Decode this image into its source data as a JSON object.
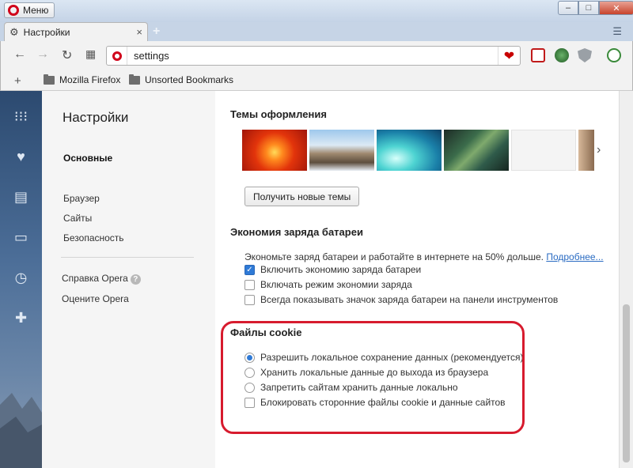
{
  "window": {
    "menu_label": "Меню",
    "controls": [
      "–",
      "□",
      "✕"
    ]
  },
  "tabs": [
    {
      "title": "Настройки",
      "close": "×"
    }
  ],
  "newtab_symbol": "+",
  "tabmenu_symbol": "☰",
  "navbar": {
    "url": "settings",
    "back": "←",
    "forward": "→",
    "reload": "↻",
    "speed_dial": "▦"
  },
  "bookmarks": {
    "add_symbol": "+",
    "items": [
      "Mozilla Firefox",
      "Unsorted Bookmarks"
    ]
  },
  "sidebar_icons": [
    "speed-dial-icon",
    "heart-icon",
    "news-icon",
    "devices-icon",
    "history-icon",
    "extensions-icon"
  ],
  "settings_nav": {
    "title": "Настройки",
    "active": "Основные",
    "items": [
      "Браузер",
      "Сайты",
      "Безопасность"
    ],
    "help": "Справка Opera",
    "rate": "Оцените Opera"
  },
  "themes": {
    "heading": "Темы оформления",
    "button": "Получить новые темы"
  },
  "battery": {
    "heading": "Экономия заряда батареи",
    "description": "Экономьте заряд батареи и работайте в интернете на 50% дольше.",
    "more_link": "Подробнее...",
    "options": [
      {
        "label": "Включить экономию заряда батареи",
        "checked": true
      },
      {
        "label": "Включать режим экономии заряда",
        "checked": false
      },
      {
        "label": "Всегда показывать значок заряда батареи на панели инструментов",
        "checked": false
      }
    ]
  },
  "cookies": {
    "heading": "Файлы cookie",
    "radios": [
      {
        "label": "Разрешить локальное сохранение данных (рекомендуется)",
        "checked": true
      },
      {
        "label": "Хранить локальные данные до выхода из браузера",
        "checked": false
      },
      {
        "label": "Запретить сайтам хранить данные локально",
        "checked": false
      }
    ],
    "block_third_party": {
      "label": "Блокировать сторонние файлы cookie и данные сайтов",
      "checked": false
    }
  },
  "colors": {
    "accent": "#2f7ad6",
    "opera_red": "#d0021b",
    "highlight": "#d71b2e",
    "link": "#2a6bc2"
  }
}
